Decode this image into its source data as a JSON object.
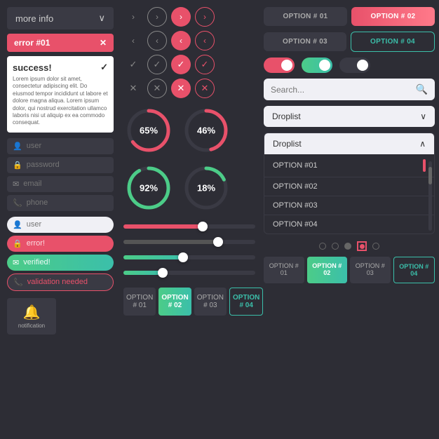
{
  "left": {
    "dropdown_label": "more info",
    "dropdown_chevron": "∨",
    "error_label": "error #01",
    "error_x": "✕",
    "success_title": "success!",
    "success_check": "✓",
    "success_body": "Lorem ipsum dolor sit amet, consectetur adipiscing elit. Do eiusmod tempor incididunt ut labore et dolore magna aliqua. Lorem ipsum dolor, qui nostrud exercitation ullamco laboris nisi ut aliquip ex ea commodo consequat.",
    "fields": [
      {
        "icon": "👤",
        "placeholder": "user",
        "type": "dark"
      },
      {
        "icon": "🔒",
        "placeholder": "password",
        "type": "dark"
      },
      {
        "icon": "✉",
        "placeholder": "email",
        "type": "dark"
      },
      {
        "icon": "📞",
        "placeholder": "phone",
        "type": "dark"
      }
    ],
    "fields_light": [
      {
        "icon": "👤",
        "placeholder": "user",
        "type": "light"
      },
      {
        "icon": "🔒",
        "placeholder": "error!",
        "type": "error"
      },
      {
        "icon": "✉",
        "placeholder": "verified!",
        "type": "verified"
      },
      {
        "icon": "📞",
        "placeholder": "validation needed",
        "type": "warning"
      }
    ],
    "notification_label": "notification",
    "bell": "🔔"
  },
  "middle": {
    "arrow_right_label": ">",
    "arrow_left_label": "<",
    "check_label": "✓",
    "cross_label": "✕",
    "circles": [
      {
        "percent": "65%",
        "value": 65,
        "color": "#e8516a"
      },
      {
        "percent": "46%",
        "value": 46,
        "color": "#e8516a"
      }
    ],
    "circles2": [
      {
        "percent": "92%",
        "value": 92,
        "color": "#4ccc88"
      },
      {
        "percent": "18%",
        "value": 18,
        "color": "#4ccc88"
      }
    ],
    "sliders": [
      {
        "fill": 60,
        "type": "red"
      },
      {
        "fill": 75,
        "type": "dark"
      },
      {
        "fill": 45,
        "type": "green"
      },
      {
        "fill": 30,
        "type": "green"
      }
    ],
    "bottom_tabs": [
      {
        "label": "OPTION # 01",
        "type": "inactive"
      },
      {
        "label": "OPTION # 02",
        "type": "active_green"
      },
      {
        "label": "OPTION # 03",
        "type": "inactive"
      },
      {
        "label": "OPTION # 04",
        "type": "outline_teal"
      }
    ]
  },
  "right": {
    "top_options_row1": [
      {
        "label": "OPTION # 01",
        "type": "inactive"
      },
      {
        "label": "OPTION # 02",
        "type": "active_red"
      }
    ],
    "top_options_row2": [
      {
        "label": "OPTION # 03",
        "type": "inactive"
      },
      {
        "label": "OPTION # 04",
        "type": "outline_red"
      }
    ],
    "toggles": [
      "red_on",
      "green_on",
      "dark_off"
    ],
    "search_placeholder": "Search...",
    "search_icon": "🔍",
    "droplist_closed_label": "Droplist",
    "droplist_open_label": "Droplist",
    "droplist_options": [
      "OPTION #01",
      "OPTION #02",
      "OPTION #03",
      "OPTION #04"
    ],
    "radio_states": [
      "empty",
      "empty",
      "empty",
      "selected",
      "empty"
    ]
  }
}
